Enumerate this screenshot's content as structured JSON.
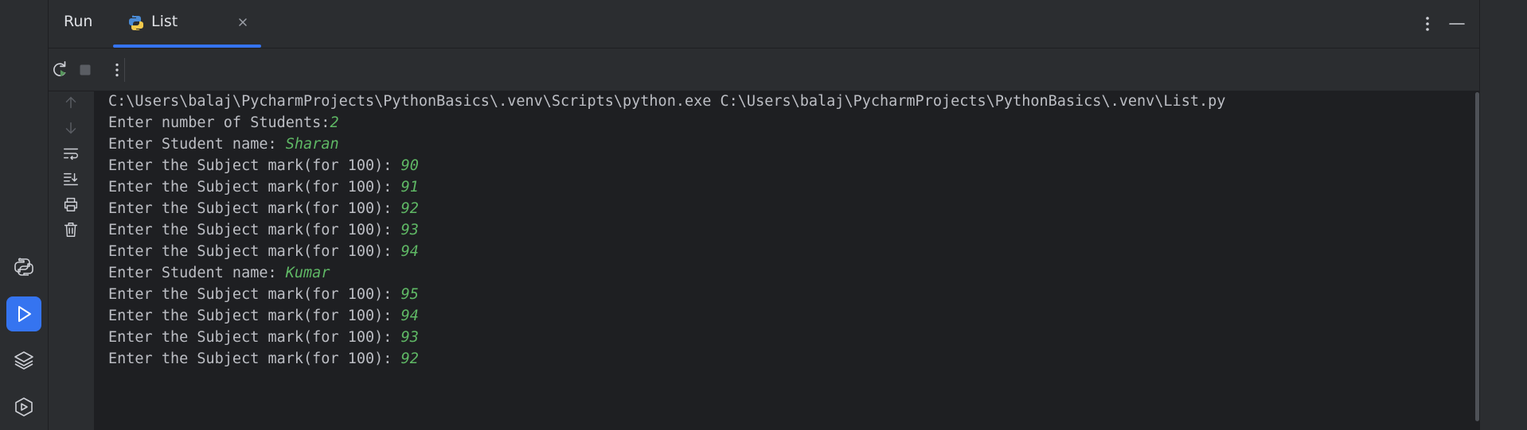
{
  "app": {
    "tool_window_title": "Run",
    "tab_label": "List"
  },
  "left_strip": {
    "items": [
      {
        "icon": "python-console-icon",
        "active": false
      },
      {
        "icon": "run-icon",
        "active": true
      },
      {
        "icon": "layers-icon",
        "active": false
      },
      {
        "icon": "services-icon",
        "active": false
      }
    ]
  },
  "toolbar": {
    "rerun_icon": "rerun-icon",
    "stop_icon": "stop-icon",
    "more_icon": "more-vertical-icon"
  },
  "console": {
    "lines": [
      {
        "text": "C:\\Users\\balaj\\PycharmProjects\\PythonBasics\\.venv\\Scripts\\python.exe C:\\Users\\balaj\\PycharmProjects\\PythonBasics\\.venv\\List.py",
        "input": ""
      },
      {
        "text": "Enter number of Students:",
        "input": "2"
      },
      {
        "text": "Enter Student name: ",
        "input": "Sharan"
      },
      {
        "text": "Enter the Subject mark(for 100): ",
        "input": "90"
      },
      {
        "text": "Enter the Subject mark(for 100): ",
        "input": "91"
      },
      {
        "text": "Enter the Subject mark(for 100): ",
        "input": "92"
      },
      {
        "text": "Enter the Subject mark(for 100): ",
        "input": "93"
      },
      {
        "text": "Enter the Subject mark(for 100): ",
        "input": "94"
      },
      {
        "text": "Enter Student name: ",
        "input": "Kumar"
      },
      {
        "text": "Enter the Subject mark(for 100): ",
        "input": "95"
      },
      {
        "text": "Enter the Subject mark(for 100): ",
        "input": "94"
      },
      {
        "text": "Enter the Subject mark(for 100): ",
        "input": "93"
      },
      {
        "text": "Enter the Subject mark(for 100): ",
        "input": "92"
      }
    ]
  },
  "colors": {
    "accent": "#3574f0",
    "console_bg": "#1e1f22",
    "panel_bg": "#2b2d30",
    "console_text": "#bcbec4",
    "user_input": "#5fb865"
  }
}
